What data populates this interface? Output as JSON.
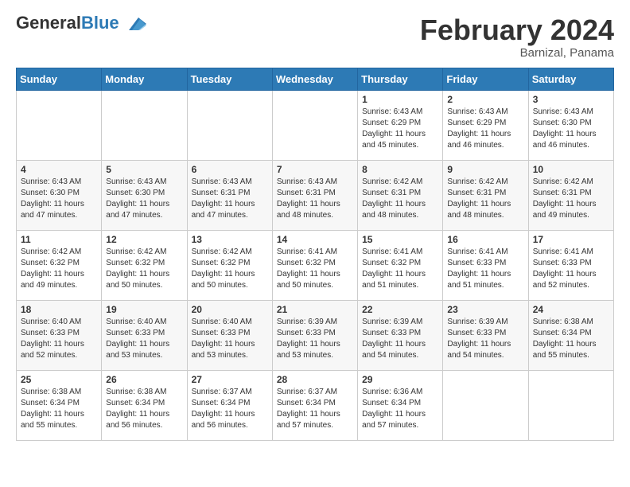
{
  "logo": {
    "line1": "General",
    "line2": "Blue"
  },
  "title": "February 2024",
  "subtitle": "Barnizal, Panama",
  "days_of_week": [
    "Sunday",
    "Monday",
    "Tuesday",
    "Wednesday",
    "Thursday",
    "Friday",
    "Saturday"
  ],
  "weeks": [
    [
      {
        "day": "",
        "info": ""
      },
      {
        "day": "",
        "info": ""
      },
      {
        "day": "",
        "info": ""
      },
      {
        "day": "",
        "info": ""
      },
      {
        "day": "1",
        "info": "Sunrise: 6:43 AM\nSunset: 6:29 PM\nDaylight: 11 hours and 45 minutes."
      },
      {
        "day": "2",
        "info": "Sunrise: 6:43 AM\nSunset: 6:29 PM\nDaylight: 11 hours and 46 minutes."
      },
      {
        "day": "3",
        "info": "Sunrise: 6:43 AM\nSunset: 6:30 PM\nDaylight: 11 hours and 46 minutes."
      }
    ],
    [
      {
        "day": "4",
        "info": "Sunrise: 6:43 AM\nSunset: 6:30 PM\nDaylight: 11 hours and 47 minutes."
      },
      {
        "day": "5",
        "info": "Sunrise: 6:43 AM\nSunset: 6:30 PM\nDaylight: 11 hours and 47 minutes."
      },
      {
        "day": "6",
        "info": "Sunrise: 6:43 AM\nSunset: 6:31 PM\nDaylight: 11 hours and 47 minutes."
      },
      {
        "day": "7",
        "info": "Sunrise: 6:43 AM\nSunset: 6:31 PM\nDaylight: 11 hours and 48 minutes."
      },
      {
        "day": "8",
        "info": "Sunrise: 6:42 AM\nSunset: 6:31 PM\nDaylight: 11 hours and 48 minutes."
      },
      {
        "day": "9",
        "info": "Sunrise: 6:42 AM\nSunset: 6:31 PM\nDaylight: 11 hours and 48 minutes."
      },
      {
        "day": "10",
        "info": "Sunrise: 6:42 AM\nSunset: 6:31 PM\nDaylight: 11 hours and 49 minutes."
      }
    ],
    [
      {
        "day": "11",
        "info": "Sunrise: 6:42 AM\nSunset: 6:32 PM\nDaylight: 11 hours and 49 minutes."
      },
      {
        "day": "12",
        "info": "Sunrise: 6:42 AM\nSunset: 6:32 PM\nDaylight: 11 hours and 50 minutes."
      },
      {
        "day": "13",
        "info": "Sunrise: 6:42 AM\nSunset: 6:32 PM\nDaylight: 11 hours and 50 minutes."
      },
      {
        "day": "14",
        "info": "Sunrise: 6:41 AM\nSunset: 6:32 PM\nDaylight: 11 hours and 50 minutes."
      },
      {
        "day": "15",
        "info": "Sunrise: 6:41 AM\nSunset: 6:32 PM\nDaylight: 11 hours and 51 minutes."
      },
      {
        "day": "16",
        "info": "Sunrise: 6:41 AM\nSunset: 6:33 PM\nDaylight: 11 hours and 51 minutes."
      },
      {
        "day": "17",
        "info": "Sunrise: 6:41 AM\nSunset: 6:33 PM\nDaylight: 11 hours and 52 minutes."
      }
    ],
    [
      {
        "day": "18",
        "info": "Sunrise: 6:40 AM\nSunset: 6:33 PM\nDaylight: 11 hours and 52 minutes."
      },
      {
        "day": "19",
        "info": "Sunrise: 6:40 AM\nSunset: 6:33 PM\nDaylight: 11 hours and 53 minutes."
      },
      {
        "day": "20",
        "info": "Sunrise: 6:40 AM\nSunset: 6:33 PM\nDaylight: 11 hours and 53 minutes."
      },
      {
        "day": "21",
        "info": "Sunrise: 6:39 AM\nSunset: 6:33 PM\nDaylight: 11 hours and 53 minutes."
      },
      {
        "day": "22",
        "info": "Sunrise: 6:39 AM\nSunset: 6:33 PM\nDaylight: 11 hours and 54 minutes."
      },
      {
        "day": "23",
        "info": "Sunrise: 6:39 AM\nSunset: 6:33 PM\nDaylight: 11 hours and 54 minutes."
      },
      {
        "day": "24",
        "info": "Sunrise: 6:38 AM\nSunset: 6:34 PM\nDaylight: 11 hours and 55 minutes."
      }
    ],
    [
      {
        "day": "25",
        "info": "Sunrise: 6:38 AM\nSunset: 6:34 PM\nDaylight: 11 hours and 55 minutes."
      },
      {
        "day": "26",
        "info": "Sunrise: 6:38 AM\nSunset: 6:34 PM\nDaylight: 11 hours and 56 minutes."
      },
      {
        "day": "27",
        "info": "Sunrise: 6:37 AM\nSunset: 6:34 PM\nDaylight: 11 hours and 56 minutes."
      },
      {
        "day": "28",
        "info": "Sunrise: 6:37 AM\nSunset: 6:34 PM\nDaylight: 11 hours and 57 minutes."
      },
      {
        "day": "29",
        "info": "Sunrise: 6:36 AM\nSunset: 6:34 PM\nDaylight: 11 hours and 57 minutes."
      },
      {
        "day": "",
        "info": ""
      },
      {
        "day": "",
        "info": ""
      }
    ]
  ]
}
